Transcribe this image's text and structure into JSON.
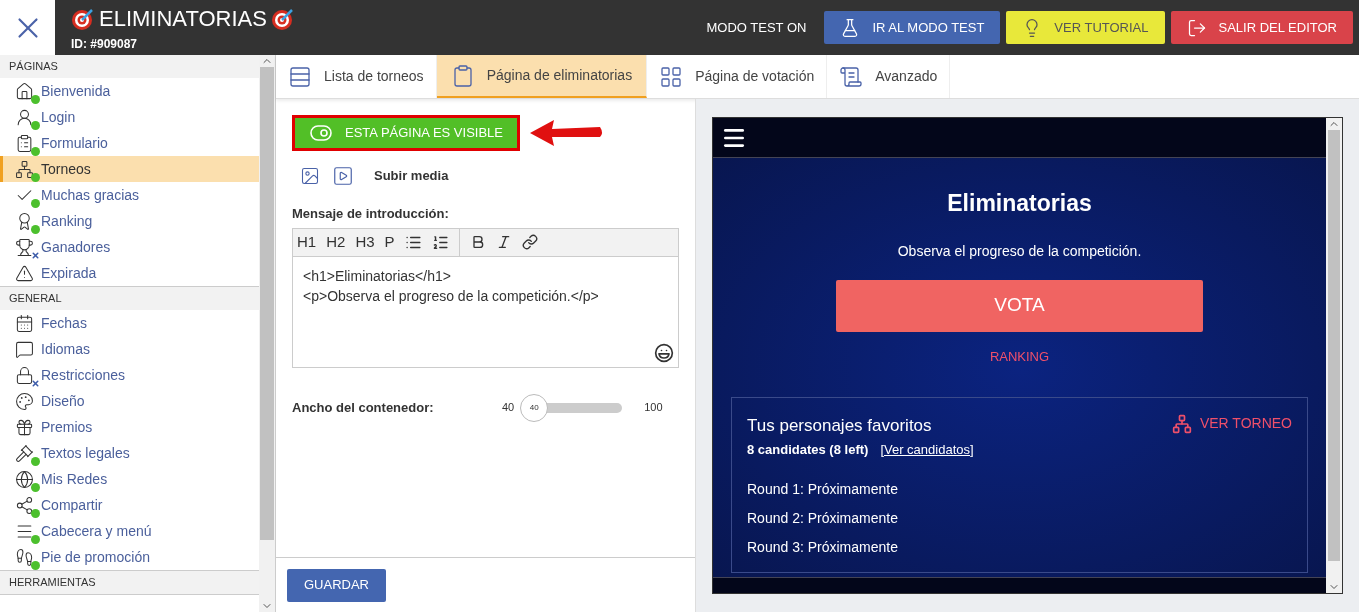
{
  "header": {
    "title": "ELIMINATORIAS",
    "id": "ID: #909087",
    "mode": "MODO TEST ON",
    "buttons": [
      {
        "label": "IR AL MODO TEST",
        "kind": "test"
      },
      {
        "label": "VER TUTORIAL",
        "kind": "tutorial"
      },
      {
        "label": "SALIR DEL EDITOR",
        "kind": "exit"
      }
    ]
  },
  "sidebar": {
    "sections": [
      {
        "title": "PÁGINAS",
        "items": [
          {
            "label": "Bienvenida",
            "selected": false,
            "kind": "dot"
          },
          {
            "label": "Login",
            "selected": false,
            "kind": "dot"
          },
          {
            "label": "Formulario",
            "selected": false,
            "kind": "dot"
          },
          {
            "label": "Torneos",
            "selected": true,
            "kind": "dot"
          },
          {
            "label": "Muchas gracias",
            "selected": false,
            "kind": "dot"
          },
          {
            "label": "Ranking",
            "selected": false,
            "kind": "dot"
          },
          {
            "label": "Ganadores",
            "selected": false,
            "kind": "cross"
          },
          {
            "label": "Expirada",
            "selected": false,
            "kind": "plain"
          }
        ]
      },
      {
        "title": "GENERAL",
        "items": [
          {
            "label": "Fechas",
            "selected": false,
            "kind": "plain"
          },
          {
            "label": "Idiomas",
            "selected": false,
            "kind": "plain"
          },
          {
            "label": "Restricciones",
            "selected": false,
            "kind": "cross"
          },
          {
            "label": "Diseño",
            "selected": false,
            "kind": "plain"
          },
          {
            "label": "Premios",
            "selected": false,
            "kind": "plain"
          },
          {
            "label": "Textos legales",
            "selected": false,
            "kind": "dot"
          },
          {
            "label": "Mis Redes",
            "selected": false,
            "kind": "dot"
          },
          {
            "label": "Compartir",
            "selected": false,
            "kind": "dot"
          },
          {
            "label": "Cabecera y menú",
            "selected": false,
            "kind": "dot"
          },
          {
            "label": "Pie de promoción",
            "selected": false,
            "kind": "dot"
          }
        ]
      },
      {
        "title": "HERRAMIENTAS"
      }
    ]
  },
  "tabs": [
    {
      "label": "Lista de torneos",
      "selected": false
    },
    {
      "label": "Página de eliminatorias",
      "selected": true
    },
    {
      "label": "Página de votación",
      "selected": false
    },
    {
      "label": "Avanzado",
      "selected": false
    }
  ],
  "editor": {
    "visibility_button": "ESTA PÁGINA ES VISIBLE",
    "visible": true,
    "media_label": "Subir media",
    "intro_label": "Mensaje de introducción:",
    "toolbar": [
      "H1",
      "H2",
      "H3",
      "P"
    ],
    "content": [
      "<h1>Eliminatorias</h1>",
      "<p>Observa el progreso de la competición.</p>"
    ],
    "width": {
      "label": "Ancho del contenedor:",
      "min": "40",
      "value": "40",
      "max": "100",
      "level": 0
    },
    "save": "GUARDAR"
  },
  "preview": {
    "title": "Eliminatorias",
    "subtitle": "Observa el progreso de la competición.",
    "vote": "VOTA",
    "ranking": "RANKING",
    "card": {
      "title": "Tus personajes favoritos",
      "count": "8 candidates (8 left)",
      "link": "[Ver candidatos]",
      "action": "VER TORNEO",
      "rounds": [
        "Round 1: Próximamente",
        "Round 2: Próximamente",
        "Round 3: Próximamente"
      ]
    }
  }
}
